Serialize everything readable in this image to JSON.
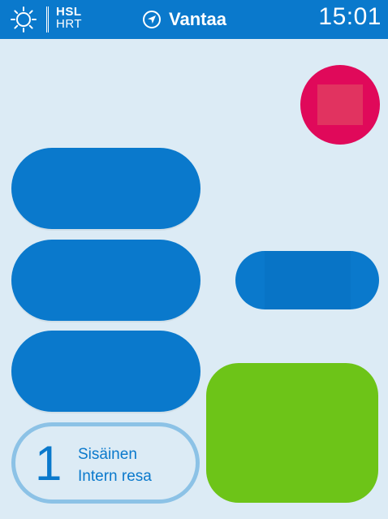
{
  "header": {
    "logo_line1": "HSL",
    "logo_line2": "HRT",
    "location": "Vantaa",
    "time": "15:01"
  },
  "ticket": {
    "zone_number": "1",
    "name_fi": "Sisäinen",
    "name_sv": "Intern resa"
  },
  "colors": {
    "primary": "#0a79cc",
    "background": "#dcebf5",
    "stop": "#e0095a",
    "go": "#6dc418",
    "ticket_border": "#8cc2e6"
  },
  "icons": {
    "logo": "hsl-sun-icon",
    "location": "location-arrow-icon",
    "stop": "stop-square-icon"
  }
}
